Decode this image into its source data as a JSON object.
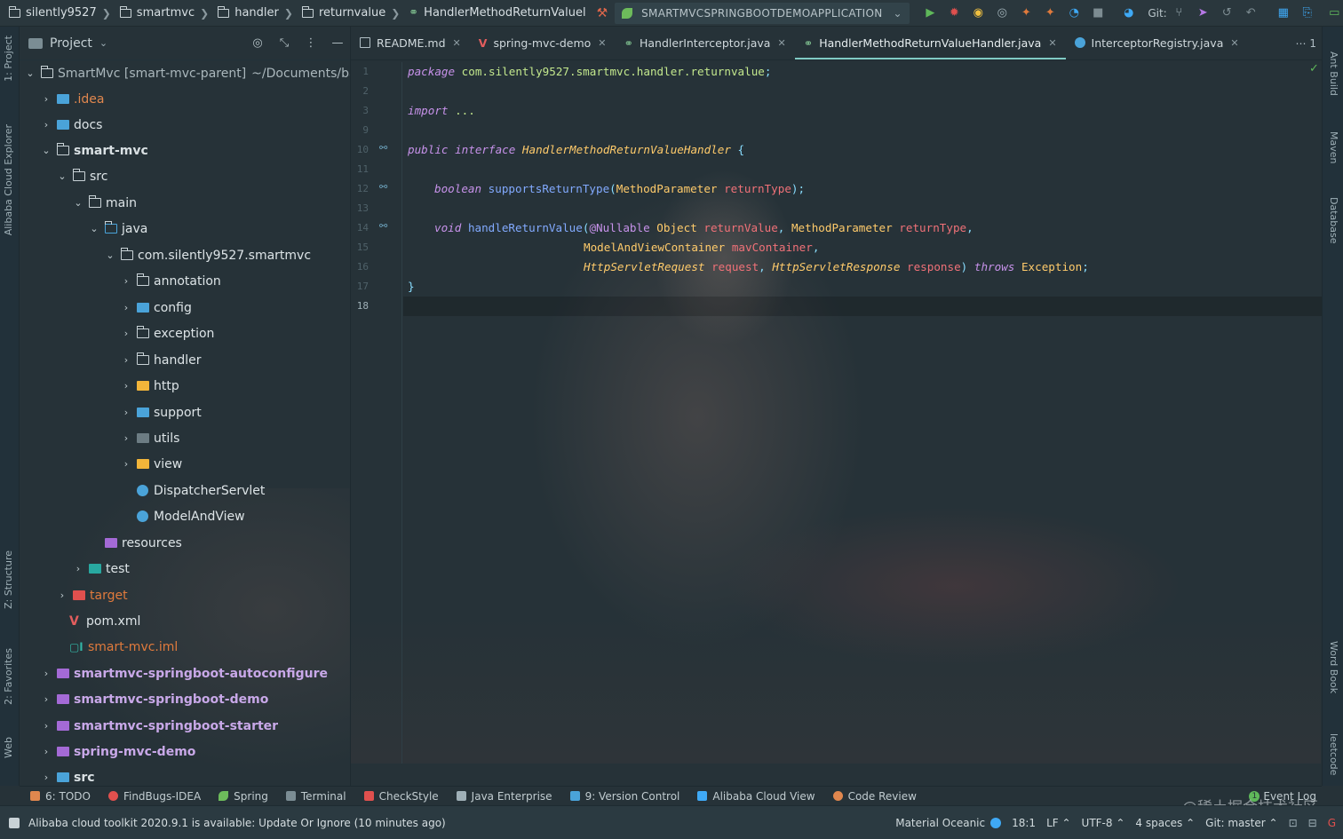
{
  "navbar": {
    "crumbs": [
      "silently9527",
      "smartmvc",
      "handler",
      "returnvalue",
      "HandlerMethodReturnValuel"
    ],
    "run_config": "SMARTMVCSPRINGBOOTDEMOAPPLICATION",
    "git_label": "Git:"
  },
  "left_stripe": {
    "project": "1: Project",
    "alibaba": "Alibaba Cloud Explorer",
    "structure": "Z: Structure",
    "favorites": "2: Favorites",
    "web": "Web"
  },
  "right_stripe": {
    "ant": "Ant Build",
    "maven": "Maven",
    "database": "Database",
    "wordbook": "Word Book",
    "leetcode": "leetcode"
  },
  "project_panel": {
    "title": "Project",
    "root_name": "SmartMvc [smart-mvc-parent]",
    "root_path": "~/Documents/ba",
    "items": [
      ".idea",
      "docs",
      "smart-mvc",
      "src",
      "main",
      "java",
      "com.silently9527.smartmvc",
      "annotation",
      "config",
      "exception",
      "handler",
      "http",
      "support",
      "utils",
      "view",
      "DispatcherServlet",
      "ModelAndView",
      "resources",
      "test",
      "target",
      "pom.xml",
      "smart-mvc.iml",
      "smartmvc-springboot-autoconfigure",
      "smartmvc-springboot-demo",
      "smartmvc-springboot-starter",
      "spring-mvc-demo",
      "src"
    ]
  },
  "tabs": [
    {
      "label": "README.md"
    },
    {
      "label": "spring-mvc-demo"
    },
    {
      "label": "HandlerInterceptor.java"
    },
    {
      "label": "HandlerMethodReturnValueHandler.java"
    },
    {
      "label": "InterceptorRegistry.java"
    }
  ],
  "tabs_more": "⋯ 1",
  "editor": {
    "line_numbers": [
      "1",
      "2",
      "3",
      "9",
      "10",
      "11",
      "12",
      "13",
      "14",
      "15",
      "16",
      "17",
      "18"
    ],
    "code": {
      "l1_kw": "package",
      "l1_pkg": "com.silently9527.smartmvc.handler.returnvalue",
      "l1_end": ";",
      "l3_kw": "import",
      "l3_dots": " ...",
      "l10_kw": "public interface",
      "l10_name": "HandlerMethodReturnValueHandler",
      "l10_brace": " {",
      "l12_kw": "boolean",
      "l12_fn": "supportsReturnType",
      "l12_p1": "(",
      "l12_type": "MethodParameter",
      "l12_param": "returnType",
      "l12_end": ");",
      "l14_kw": "void",
      "l14_fn": "handleReturnValue",
      "l14_p1": "(",
      "l14_anno": "@Nullable",
      "l14_t1": "Object",
      "l14_a1": "returnValue",
      "l14_comma1": ",",
      "l14_t2": "MethodParameter",
      "l14_a2": "returnType",
      "l14_comma2": ",",
      "l15_t": "ModelAndViewContainer",
      "l15_a": "mavContainer",
      "l15_comma": ",",
      "l16_t1": "HttpServletRequest",
      "l16_a1": "request",
      "l16_comma": ",",
      "l16_t2": "HttpServletResponse",
      "l16_a2": "response",
      "l16_close": ")",
      "l16_throws": "throws",
      "l16_ex": "Exception",
      "l16_end": ";",
      "l17": "}"
    }
  },
  "bottom_tools": [
    "6: TODO",
    "FindBugs-IDEA",
    "Spring",
    "Terminal",
    "CheckStyle",
    "Java Enterprise",
    "9: Version Control",
    "Alibaba Cloud View",
    "Code Review"
  ],
  "event_log": "Event Log",
  "event_count": "1",
  "status": {
    "message": "Alibaba cloud toolkit 2020.9.1 is available: Update Or Ignore (10 minutes ago)",
    "theme": "Material Oceanic",
    "position": "18:1",
    "line_sep": "LF ⌃",
    "encoding": "UTF-8 ⌃",
    "indent": "4 spaces ⌃",
    "branch": "Git: master ⌃"
  },
  "watermark": "@稀土掘金技术社区",
  "colors": {
    "accent": "#80cbc4",
    "background": "#263238",
    "keyword": "#c792ea",
    "type": "#ffcb6b",
    "function": "#82aaff",
    "param": "#f07178",
    "package": "#c3e88d"
  }
}
